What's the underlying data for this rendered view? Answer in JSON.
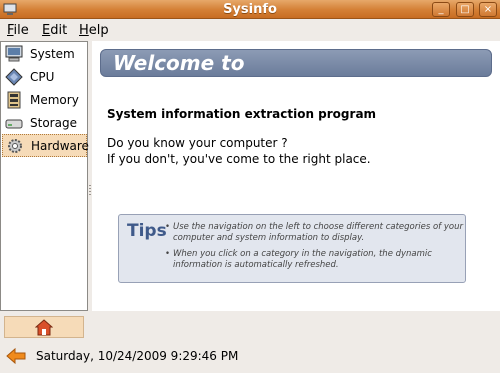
{
  "window": {
    "title": "Sysinfo",
    "controls": [
      "minimize",
      "maximize",
      "close"
    ]
  },
  "menu": {
    "file": "File",
    "edit": "Edit",
    "help": "Help"
  },
  "sidebar": {
    "items": [
      {
        "label": "System",
        "icon": "computer-icon"
      },
      {
        "label": "CPU",
        "icon": "cpu-icon"
      },
      {
        "label": "Memory",
        "icon": "memory-icon"
      },
      {
        "label": "Storage",
        "icon": "storage-icon"
      },
      {
        "label": "Hardware",
        "icon": "gear-icon",
        "selected": true
      }
    ],
    "home_icon": "home-icon"
  },
  "main": {
    "banner": "Welcome to",
    "heading": "System information extraction program",
    "line1": "Do you know your computer ?",
    "line2": "If you don't, you've come to the right place.",
    "tips": {
      "label": "Tips",
      "items": [
        "Use the navigation on the left to choose different categories of your computer and system information to display.",
        "When you click on a category in the navigation, the dynamic information is automatically refreshed."
      ]
    }
  },
  "status": {
    "datetime": "Saturday, 10/24/2009 9:29:46 PM",
    "icon": "back-arrow-icon"
  },
  "colors": {
    "titlebar": "#d47f35",
    "selection": "#f6dbb8",
    "banner": "#7b8aa8"
  }
}
